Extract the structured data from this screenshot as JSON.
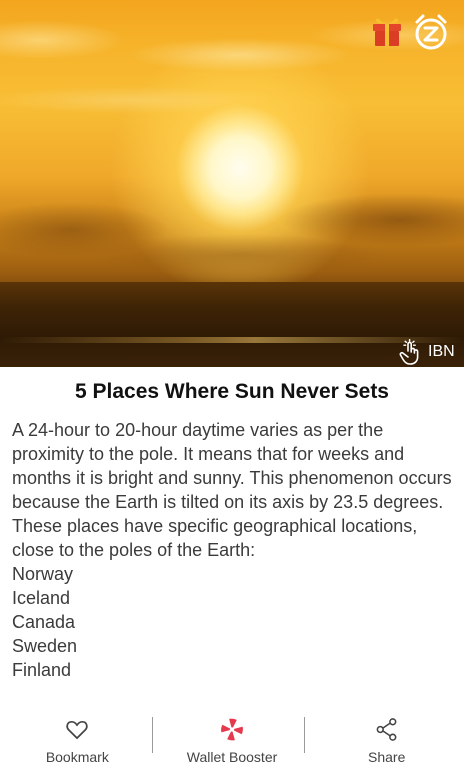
{
  "hero": {
    "source_label": "IBN"
  },
  "article": {
    "title": "5 Places Where Sun Never Sets",
    "paragraph": "A 24-hour to 20-hour daytime varies as per the proximity to the pole. It means that for weeks and months it is bright and sunny. This phenomenon occurs because the Earth is tilted on its axis by 23.5 degrees. These places have specific geographical locations, close to the poles of the Earth:",
    "places": [
      "Norway",
      "Iceland",
      "Canada",
      "Sweden",
      "Finland"
    ]
  },
  "bottom_bar": {
    "bookmark_label": "Bookmark",
    "wallet_label": "Wallet Booster",
    "share_label": "Share"
  },
  "icons": {
    "gift": "gift-icon",
    "snooze": "alarm-snooze-icon",
    "tap": "tap-icon",
    "bookmark": "heart-icon",
    "wallet": "pinwheel-icon",
    "share": "share-icon"
  },
  "colors": {
    "gift_red": "#e4462b",
    "gift_gold": "#f6c02e",
    "wallet_red": "#e53a4e",
    "text_title": "#111111",
    "text_body": "#3b3b3b"
  }
}
